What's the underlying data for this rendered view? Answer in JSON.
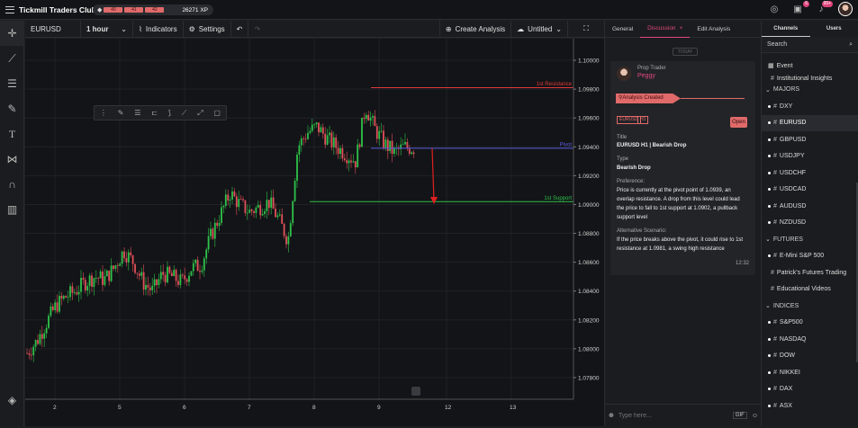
{
  "app": {
    "title": "Tickmill Traders Club",
    "xp_levels": [
      "40",
      "41",
      "42"
    ],
    "xp": "26271 XP",
    "badge_mail": "6",
    "badge_notif": "99+"
  },
  "toolbar": {
    "symbol": "EURUSD",
    "interval": "1 hour",
    "indicators": "Indicators",
    "settings": "Settings",
    "create_analysis": "Create Analysis",
    "layout": "Untitled"
  },
  "chart_labels": {
    "resistance": "1st Resistance",
    "pivot": "Pivot",
    "support": "1st Support",
    "res_price": "1.0981",
    "pivot_price": "1.0939",
    "sup_price": "1.0902"
  },
  "chart_data": {
    "type": "candlestick",
    "symbol": "EURUSD",
    "interval": "1 hour",
    "x_ticks": [
      "2",
      "5",
      "6",
      "7",
      "8",
      "9",
      "12",
      "13"
    ],
    "y_ticks": [
      "1.10000",
      "1.09800",
      "1.09600",
      "1.09400",
      "1.09200",
      "1.09000",
      "1.08800",
      "1.08600",
      "1.08400",
      "1.08200",
      "1.08000",
      "1.07800"
    ],
    "ylim": [
      1.0765,
      1.1015
    ],
    "levels": [
      {
        "name": "1st Resistance",
        "value": 1.0981,
        "color": "#e03a3a"
      },
      {
        "name": "Pivot",
        "value": 1.0939,
        "color": "#5a5ae0"
      },
      {
        "name": "1st Support",
        "value": 1.0902,
        "color": "#2ec24a"
      }
    ],
    "close_path": [
      1.0797,
      1.0805,
      1.0818,
      1.083,
      1.0836,
      1.084,
      1.0846,
      1.085,
      1.0848,
      1.0856,
      1.0868,
      1.086,
      1.0846,
      1.084,
      1.0852,
      1.085,
      1.0846,
      1.0856,
      1.0858,
      1.0878,
      1.0893,
      1.0908,
      1.09,
      1.0895,
      1.0898,
      1.0902,
      1.089,
      1.0875,
      1.094,
      1.095,
      1.0954,
      1.0946,
      1.094,
      1.0935,
      1.093,
      1.0968,
      1.0952,
      1.0942,
      1.0936,
      1.094,
      1.0939
    ]
  },
  "discussion": {
    "tabs": [
      "General",
      "Discussion",
      "Edit Analysis"
    ],
    "today": "TODAY",
    "role": "Prop Trader",
    "author": "Peggy",
    "banner": "Analysis Created",
    "pills": [
      "EURUSD",
      "H1"
    ],
    "open": "Open",
    "title_label": "Title",
    "title": "EURUSD H1 | Bearish Drop",
    "type_label": "Type",
    "type": "Bearish Drop",
    "pref_label": "Preference:",
    "pref_lines": [
      "Price is currently at the pivot point of 1.0939, an",
      "overlap resistance. A drop from this level could lead",
      "the price to fall to 1st support at 1.0902, a pullback",
      "support level"
    ],
    "alt_label": "Alternative Scenario:",
    "alt_lines": [
      "If the price breaks above the pivot, it could rise to 1st",
      "resistance at 1.0981, a swing high resistance"
    ],
    "time": "12:32",
    "input_placeholder": "Type here...",
    "gif": "GIF"
  },
  "channels": {
    "tabs": [
      "Channels",
      "Users"
    ],
    "search": "Search",
    "items": [
      {
        "kind": "item",
        "label": "Event",
        "icon": "calendar-icon"
      },
      {
        "kind": "item",
        "label": "Institutional Insights"
      },
      {
        "kind": "header",
        "label": "MAJORS"
      },
      {
        "kind": "item",
        "label": "DXY",
        "dot": true
      },
      {
        "kind": "item",
        "label": "EURUSD",
        "dot": true,
        "selected": true
      },
      {
        "kind": "item",
        "label": "GBPUSD",
        "dot": true
      },
      {
        "kind": "item",
        "label": "USDJPY",
        "dot": true
      },
      {
        "kind": "item",
        "label": "USDCHF",
        "dot": true
      },
      {
        "kind": "item",
        "label": "USDCAD",
        "dot": true
      },
      {
        "kind": "item",
        "label": "AUDUSD",
        "dot": true
      },
      {
        "kind": "item",
        "label": "NZDUSD",
        "dot": true
      },
      {
        "kind": "header",
        "label": "FUTURES"
      },
      {
        "kind": "item",
        "label": "E-Mini S&P 500",
        "dot": true
      },
      {
        "kind": "item",
        "label": "Patrick's Futures Trading"
      },
      {
        "kind": "item",
        "label": "Educational Videos"
      },
      {
        "kind": "header",
        "label": "INDICES"
      },
      {
        "kind": "item",
        "label": "S&P500",
        "dot": true
      },
      {
        "kind": "item",
        "label": "NASDAQ",
        "dot": true
      },
      {
        "kind": "item",
        "label": "DOW",
        "dot": true
      },
      {
        "kind": "item",
        "label": "NIKKEI",
        "dot": true
      },
      {
        "kind": "item",
        "label": "DAX",
        "dot": true
      },
      {
        "kind": "item",
        "label": "ASX",
        "dot": true
      }
    ]
  }
}
